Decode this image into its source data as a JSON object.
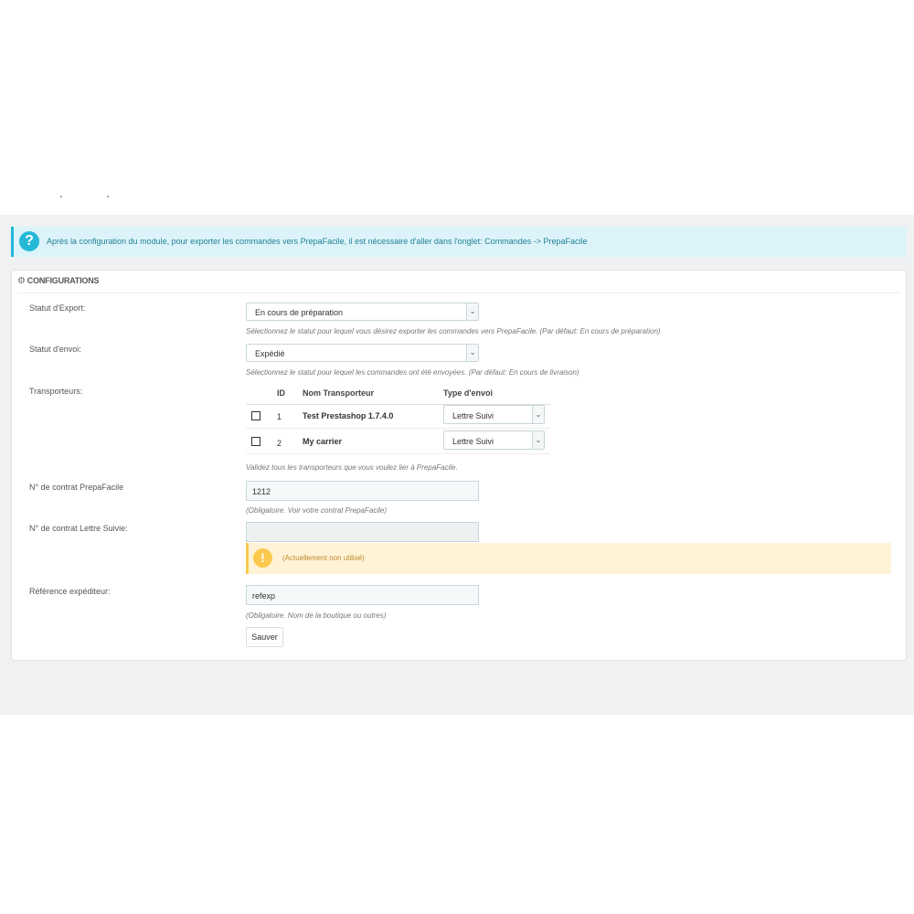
{
  "info_alert": {
    "icon": "question-icon",
    "text": "Après la configuration du module, pour exporter les commandes vers PrepaFacile, il est nécessaire d'aller dans l'onglet: Commandes -> PrepaFacile"
  },
  "panel": {
    "heading": "CONFIGURATIONS",
    "heading_icon": "cogs-icon"
  },
  "export_status": {
    "label": "Statut d'Export:",
    "value": "En cours de préparation",
    "help": "Sélectionnez le statut pour lequel vous désirez exporter les commandes vers PrepaFacile. (Par défaut: En cours de préparation)"
  },
  "shipping_status": {
    "label": "Statut d'envoi:",
    "value": "Expédié",
    "help": "Sélectionnez le statut pour lequel les commandes ont été envoyées. (Par défaut: En cours de livraison)"
  },
  "carriers": {
    "label": "Transporteurs:",
    "headers": {
      "id": "ID",
      "name": "Nom Transporteur",
      "type": "Type d'envoi"
    },
    "rows": [
      {
        "id": "1",
        "name": "Test Prestashop 1.7.4.0",
        "type": "Lettre Suivi",
        "checked": false
      },
      {
        "id": "2",
        "name": "My carrier",
        "type": "Lettre Suivi",
        "checked": false
      }
    ],
    "help": "Validez tous les transporteurs que vous voulez lier à PrepaFacile."
  },
  "contract_prepafacile": {
    "label": "N° de contrat PrepaFacile",
    "value": "1212",
    "help": "(Obligatoire. Voir votre contrat PrepaFacile)"
  },
  "contract_lettre_suivie": {
    "label": "N° de contrat Lettre Suivie:",
    "value": "",
    "warning": "(Actuellement non utilisé)",
    "warning_icon": "exclamation-icon"
  },
  "sender_reference": {
    "label": "Référence expéditeur:",
    "value": "refexp",
    "help": "(Obligatoire. Nom de la boutique ou outres)"
  },
  "save_button": "Sauver",
  "colors": {
    "info_accent": "#25b9d7",
    "info_bg": "#dcf4f9",
    "warning_accent": "#fcc94f",
    "warning_bg": "#fff3d7",
    "page_bg": "#eff1f2"
  }
}
